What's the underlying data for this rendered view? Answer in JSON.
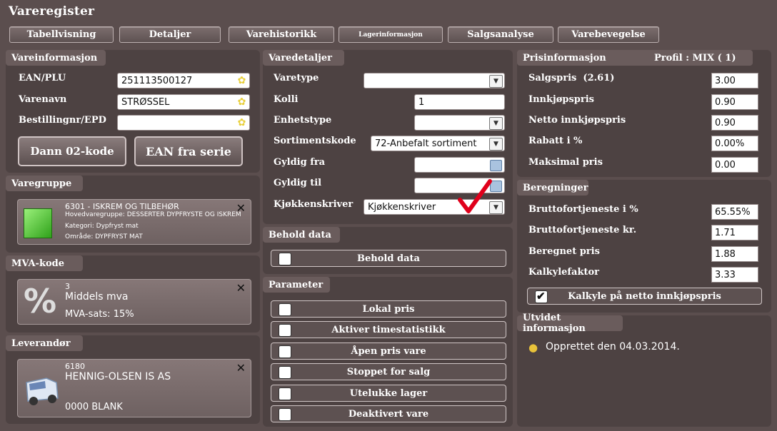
{
  "app_title": "Vareregister",
  "tabs": [
    "Tabellvisning",
    "Detaljer",
    "Varehistorikk",
    "Lagerinformasjon",
    "Salgsanalyse",
    "Varebevegelse"
  ],
  "vareinfo": {
    "title": "Vareinformasjon",
    "ean_label": "EAN/PLU",
    "ean_value": "251113500127",
    "varenavn_label": "Varenavn",
    "varenavn_value": "STRØSSEL",
    "bestilling_label": "Bestillingnr/EPD",
    "bestilling_value": "",
    "btn_dann": "Dann 02-kode",
    "btn_ean": "EAN fra serie"
  },
  "varegruppe": {
    "title": "Varegruppe",
    "line1": "6301 - ISKREM OG TILBEHØR",
    "line2": "Hovedvaregruppe: DESSERTER DYPFRYSTE OG ISKREM",
    "line3": "Kategori: Dypfryst mat",
    "line4": "Område: DYPFRYST MAT",
    "icon": "green-cube-icon"
  },
  "mva": {
    "title": "MVA-kode",
    "code": "3",
    "name": "Middels mva",
    "sats": "MVA-sats: 15%",
    "icon": "percent-icon"
  },
  "leverandor": {
    "title": "Leverandør",
    "code": "6180",
    "name": "HENNIG-OLSEN IS AS",
    "extra": "0000 BLANK",
    "icon": "van-icon"
  },
  "varedetaljer": {
    "title": "Varedetaljer",
    "varetype_label": "Varetype",
    "varetype_value": "",
    "kolli_label": "Kolli",
    "kolli_value": "1",
    "enhetstype_label": "Enhetstype",
    "enhetstype_value": "",
    "sortiment_label": "Sortimentskode",
    "sortiment_value": "72-Anbefalt sortiment",
    "gyldig_fra_label": "Gyldig fra",
    "gyldig_til_label": "Gyldig til",
    "kjokken_label": "Kjøkkenskriver",
    "kjokken_value": "Kjøkkenskriver"
  },
  "behold": {
    "title": "Behold data",
    "checkbox_label": "Behold data"
  },
  "parameter": {
    "title": "Parameter",
    "items": [
      "Lokal pris",
      "Aktiver timestatistikk",
      "Åpen pris vare",
      "Stoppet for salg",
      "Utelukke lager",
      "Deaktivert vare"
    ]
  },
  "pris": {
    "title": "Prisinformasjon",
    "profile": "Profil : MIX ( 1)",
    "salgspris_label": "Salgspris",
    "salgspris_extra": "(2.61)",
    "salgspris_value": "3.00",
    "innkjop_label": "Innkjøpspris",
    "innkjop_value": "0.90",
    "netto_label": "Netto innkjøpspris",
    "netto_value": "0.90",
    "rabatt_label": "Rabatt i %",
    "rabatt_value": "0.00",
    "maks_label": "Maksimal pris",
    "maks_value": "0.00",
    "percent_sign": "%"
  },
  "beregninger": {
    "title": "Beregninger",
    "brutto_pct_label": "Bruttofortjeneste i %",
    "brutto_pct_value": "65.55",
    "brutto_kr_label": "Bruttofortjeneste kr.",
    "brutto_kr_value": "1.71",
    "beregnet_label": "Beregnet pris",
    "beregnet_value": "1.88",
    "kalkyle_label": "Kalkylefaktor",
    "kalkyle_value": "3.33",
    "netto_check_label": "Kalkyle på netto innkjøpspris"
  },
  "utvidet": {
    "title": "Utvidet informasjon",
    "created": "Opprettet den 04.03.2014."
  },
  "colors": {
    "background": "#5b4e4e",
    "panel": "#4d4242",
    "checkmark": "#e0001b"
  }
}
